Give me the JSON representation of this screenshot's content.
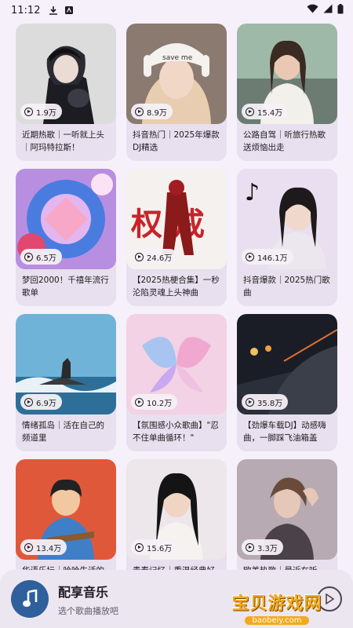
{
  "status_bar": {
    "time": "11:12",
    "icons": [
      "download-icon",
      "notification-app-icon",
      "wifi-icon",
      "signal-icon",
      "battery-icon"
    ]
  },
  "playlists": [
    {
      "plays": "1.9万",
      "title": "近期热歌｜一听就上头｜阿玛特拉斯！"
    },
    {
      "plays": "8.9万",
      "title": "抖音热门｜2025年爆款DJ精选"
    },
    {
      "plays": "15.4万",
      "title": "公路自驾｜听旅行热歌送烦恼出走"
    },
    {
      "plays": "6.5万",
      "title": "梦回2000！千禧年流行歌单"
    },
    {
      "plays": "24.6万",
      "title": "【2025热梗合集】一秒沦陷灵魂上头神曲"
    },
    {
      "plays": "146.1万",
      "title": "抖音爆款｜2025热门歌曲"
    },
    {
      "plays": "6.9万",
      "title": "情绪孤岛｜活在自己的频道里"
    },
    {
      "plays": "10.2万",
      "title": "【氛围感小众歌曲】\"忍不住单曲循环！\""
    },
    {
      "plays": "35.8万",
      "title": "【劲爆车载DJ】动感嗨曲，一脚踩飞油箱盖"
    },
    {
      "plays": "13.4万",
      "title": "华语乐坛｜哈哈生活的旋"
    },
    {
      "plays": "15.6万",
      "title": "青春记忆｜重温经典好"
    },
    {
      "plays": "3.3万",
      "title": "欧美热歌｜最近在听"
    }
  ],
  "player": {
    "name": "配享音乐",
    "subtitle": "选个歌曲播放吧"
  },
  "watermark": {
    "title": "宝贝游戏网",
    "url": "baobeiy.com"
  },
  "colors": {
    "background": "#f6f0fa",
    "card": "#e8e0ee",
    "player_disc": "#2f5f9c",
    "watermark": "#f3a91d"
  }
}
